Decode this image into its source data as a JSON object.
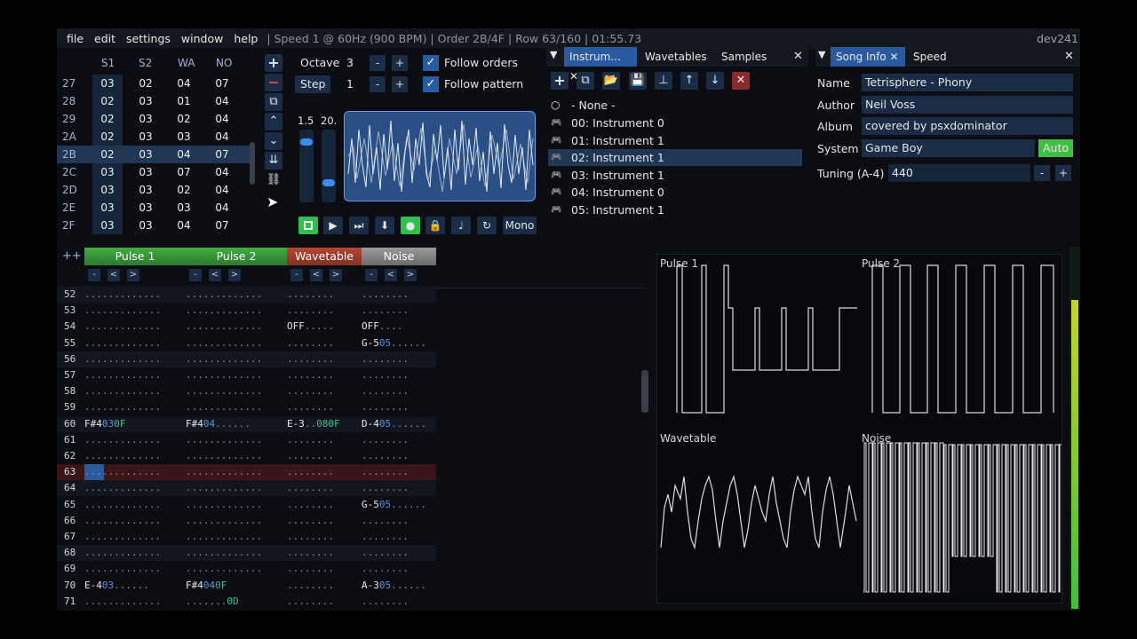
{
  "menu": {
    "items": [
      "file",
      "edit",
      "settings",
      "window",
      "help"
    ],
    "status": "| Speed 1 @ 60Hz (900 BPM) | Order 2B/4F | Row 63/160 | 01:55.73",
    "version": "dev241"
  },
  "orders": {
    "headers": [
      "S1",
      "S2",
      "WA",
      "NO"
    ],
    "rows": [
      {
        "n": "27",
        "v": [
          "03",
          "02",
          "04",
          "07"
        ]
      },
      {
        "n": "28",
        "v": [
          "02",
          "03",
          "01",
          "04"
        ]
      },
      {
        "n": "29",
        "v": [
          "02",
          "03",
          "02",
          "04"
        ]
      },
      {
        "n": "2A",
        "v": [
          "02",
          "03",
          "03",
          "04"
        ]
      },
      {
        "n": "2B",
        "v": [
          "02",
          "03",
          "04",
          "07"
        ]
      },
      {
        "n": "2C",
        "v": [
          "03",
          "03",
          "07",
          "04"
        ]
      },
      {
        "n": "2D",
        "v": [
          "03",
          "03",
          "02",
          "04"
        ]
      },
      {
        "n": "2E",
        "v": [
          "03",
          "03",
          "03",
          "04"
        ]
      },
      {
        "n": "2F",
        "v": [
          "03",
          "03",
          "04",
          "07"
        ]
      }
    ],
    "selected": "2B"
  },
  "controls": {
    "octave_label": "Octave",
    "octave_value": "3",
    "step_label": "Step",
    "step_value": "1",
    "minus": "-",
    "plus": "+",
    "follow_orders": "Follow orders",
    "follow_pattern": "Follow pattern",
    "vol_a": "1.5",
    "vol_b": "20.",
    "mono": "Mono"
  },
  "instruments": {
    "tabs": [
      "Instrum...",
      "Wavetables",
      "Samples"
    ],
    "none_label": "- None -",
    "items": [
      "00: Instrument 0",
      "01: Instrument 1",
      "02: Instrument 1",
      "03: Instrument 1",
      "04: Instrument 0",
      "05: Instrument 1"
    ],
    "selected_index": 2
  },
  "song": {
    "tabs": [
      "Song Info",
      "Speed"
    ],
    "name_label": "Name",
    "name": "Tetrisphere - Phony",
    "author_label": "Author",
    "author": "Neil Voss",
    "album_label": "Album",
    "album": "covered by psxdominator",
    "system_label": "System",
    "system": "Game Boy",
    "auto": "Auto",
    "tuning_label": "Tuning (A-4)",
    "tuning": "440"
  },
  "pattern": {
    "channels": [
      {
        "name": "Pulse 1",
        "color": "#3fae3f"
      },
      {
        "name": "Pulse 2",
        "color": "#3fae3f"
      },
      {
        "name": "Wavetable",
        "color": "#b8452e"
      },
      {
        "name": "Noise",
        "color": "#9a9a9a"
      }
    ],
    "rows": [
      {
        "n": "52",
        "cells": [
          "",
          "",
          "",
          ""
        ]
      },
      {
        "n": "53",
        "cells": [
          "",
          "",
          "",
          ""
        ]
      },
      {
        "n": "54",
        "cells": [
          "",
          "",
          "OFF",
          "OFF"
        ]
      },
      {
        "n": "55",
        "cells": [
          "",
          "",
          "",
          "G-5|05"
        ]
      },
      {
        "n": "56",
        "cells": [
          "",
          "",
          "",
          ""
        ]
      },
      {
        "n": "57",
        "cells": [
          "",
          "",
          "",
          ""
        ]
      },
      {
        "n": "58",
        "cells": [
          "",
          "",
          "",
          ""
        ]
      },
      {
        "n": "59",
        "cells": [
          "",
          "",
          "",
          ""
        ]
      },
      {
        "n": "60",
        "cells": [
          "F#4|03|0F",
          "F#4|04",
          "E-3||080F",
          "D-4|05"
        ]
      },
      {
        "n": "61",
        "cells": [
          "",
          "",
          "",
          ""
        ]
      },
      {
        "n": "62",
        "cells": [
          "",
          "",
          "",
          ""
        ]
      },
      {
        "n": "63",
        "cells": [
          "",
          "",
          "",
          ""
        ]
      },
      {
        "n": "64",
        "cells": [
          "",
          "",
          "",
          ""
        ]
      },
      {
        "n": "65",
        "cells": [
          "",
          "",
          "",
          "G-5|05"
        ]
      },
      {
        "n": "66",
        "cells": [
          "",
          "",
          "",
          ""
        ]
      },
      {
        "n": "67",
        "cells": [
          "",
          "",
          "",
          ""
        ]
      },
      {
        "n": "68",
        "cells": [
          "",
          "",
          "",
          ""
        ]
      },
      {
        "n": "69",
        "cells": [
          "",
          "",
          "",
          ""
        ]
      },
      {
        "n": "70",
        "cells": [
          "E-4|03",
          "F#4|04|0F",
          "",
          "A-3|05"
        ]
      },
      {
        "n": "71",
        "cells": [
          "",
          "0D",
          "",
          ""
        ]
      }
    ],
    "cursor_row": "63"
  },
  "scopes": [
    "Pulse 1",
    "Pulse 2",
    "Wavetable",
    "Noise"
  ],
  "colors": {
    "accent": "#2a5aa0",
    "play_green": "#2fbf4f",
    "auto_green": "#3fbf3f"
  }
}
